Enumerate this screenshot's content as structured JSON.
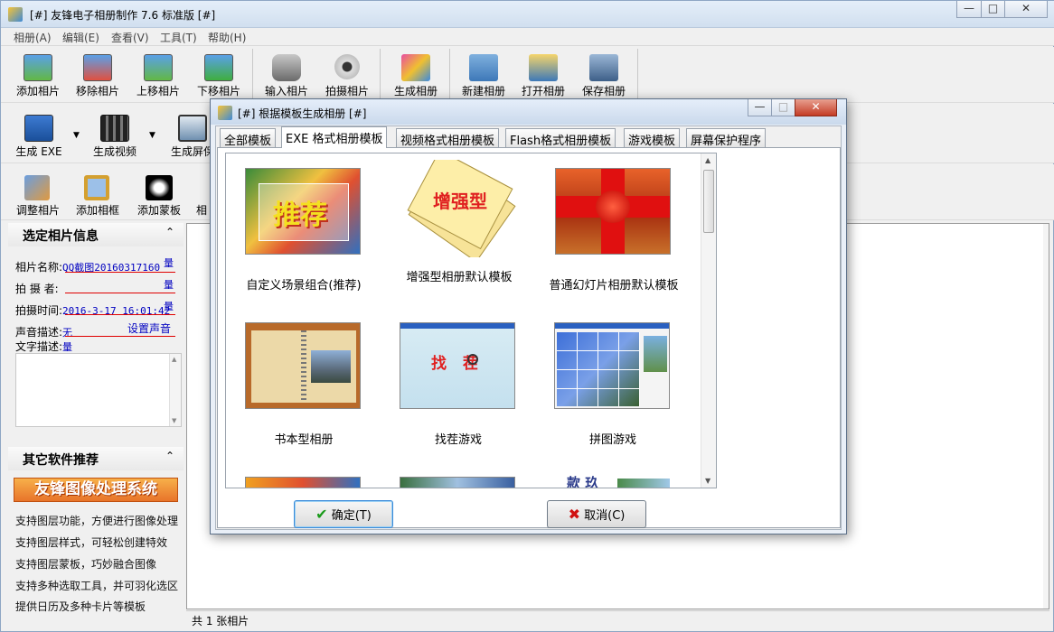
{
  "app": {
    "title": "[#] 友锋电子相册制作 7.6 标准版 [#]"
  },
  "menus": [
    "相册(A)",
    "编辑(E)",
    "查看(V)",
    "工具(T)",
    "帮助(H)"
  ],
  "toolbar1": [
    "添加相片",
    "移除相片",
    "上移相片",
    "下移相片",
    "输入相片",
    "拍摄相片",
    "生成相册",
    "新建相册",
    "打开相册",
    "保存相册"
  ],
  "toolbar2": [
    "生成 EXE",
    "生成视频",
    "生成屏保"
  ],
  "toolbar3": [
    "调整相片",
    "添加相框",
    "添加蒙板",
    "相"
  ],
  "photo_info": {
    "header": "选定相片信息",
    "name_label": "相片名称:",
    "name_value": "QQ截图20160317160",
    "photographer_label": "拍 摄 者:",
    "time_label": "拍摄时间:",
    "time_value": "2016-3-17 16:01:42",
    "sound_label": "声音描述:",
    "sound_value": "无",
    "set_sound": "设置声音",
    "text_label": "文字描述:",
    "edit_glyph": "量"
  },
  "recommend": {
    "header": "其它软件推荐",
    "banner": "友锋图像处理系统",
    "lines": [
      "支持图层功能，方便进行图像处理",
      "支持图层样式，可轻松创建特效",
      "支持图层蒙板，巧妙融合图像",
      "支持多种选取工具，并可羽化选区",
      "提供日历及多种卡片等模板"
    ]
  },
  "status": {
    "text": "共 1 张相片"
  },
  "dialog": {
    "title": "[#] 根据模板生成相册 [#]",
    "tabs": [
      "全部模板",
      "EXE 格式相册模板",
      "视频格式相册模板",
      "Flash格式相册模板",
      "游戏模板",
      "屏幕保护程序"
    ],
    "templates": [
      {
        "name": "自定义场景组合(推荐)",
        "thumb_text": "推荐"
      },
      {
        "name": "增强型相册默认模板",
        "thumb_text": "增强型"
      },
      {
        "name": "普通幻灯片相册默认模板",
        "thumb_text": ""
      },
      {
        "name": "书本型相册",
        "thumb_text": ""
      },
      {
        "name": "找茬游戏",
        "thumb_text": "找 茬"
      },
      {
        "name": "拼图游戏",
        "thumb_text": ""
      }
    ],
    "partial_thumb_text": "款 玖",
    "ok_label": "确定(T)",
    "cancel_label": "取消(C)"
  },
  "colors": {
    "accent_red": "#e00000",
    "value_blue": "#0000c0",
    "banner_orange": "#e8742a"
  }
}
